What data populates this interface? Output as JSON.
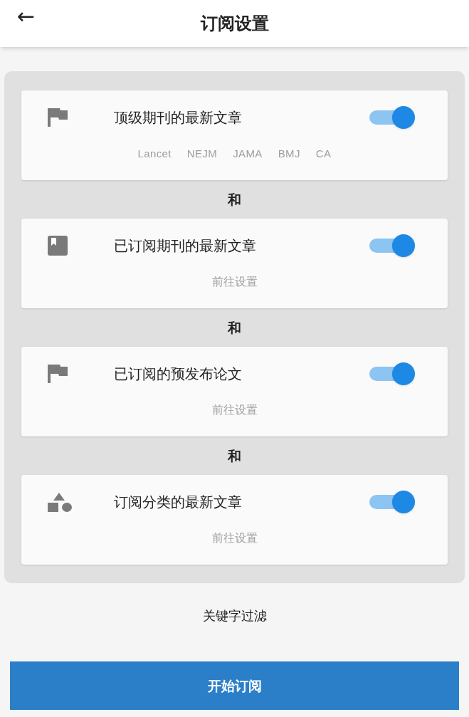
{
  "header": {
    "back": "←",
    "title": "订阅设置"
  },
  "cards": [
    {
      "kind": "tags",
      "title": "顶级期刊的最新文章",
      "on": true,
      "tags": [
        "Lancet",
        "NEJM",
        "JAMA",
        "BMJ",
        "CA"
      ]
    },
    {
      "kind": "link",
      "title": "已订阅期刊的最新文章",
      "on": true,
      "link": "前往设置"
    },
    {
      "kind": "link",
      "title": "已订阅的预发布论文",
      "on": true,
      "link": "前往设置"
    },
    {
      "kind": "link",
      "title": "订阅分类的最新文章",
      "on": true,
      "link": "前往设置"
    }
  ],
  "joiners": [
    "和",
    "和",
    "和"
  ],
  "keyword_filter": "关键字过滤",
  "submit_button": "开始订阅"
}
